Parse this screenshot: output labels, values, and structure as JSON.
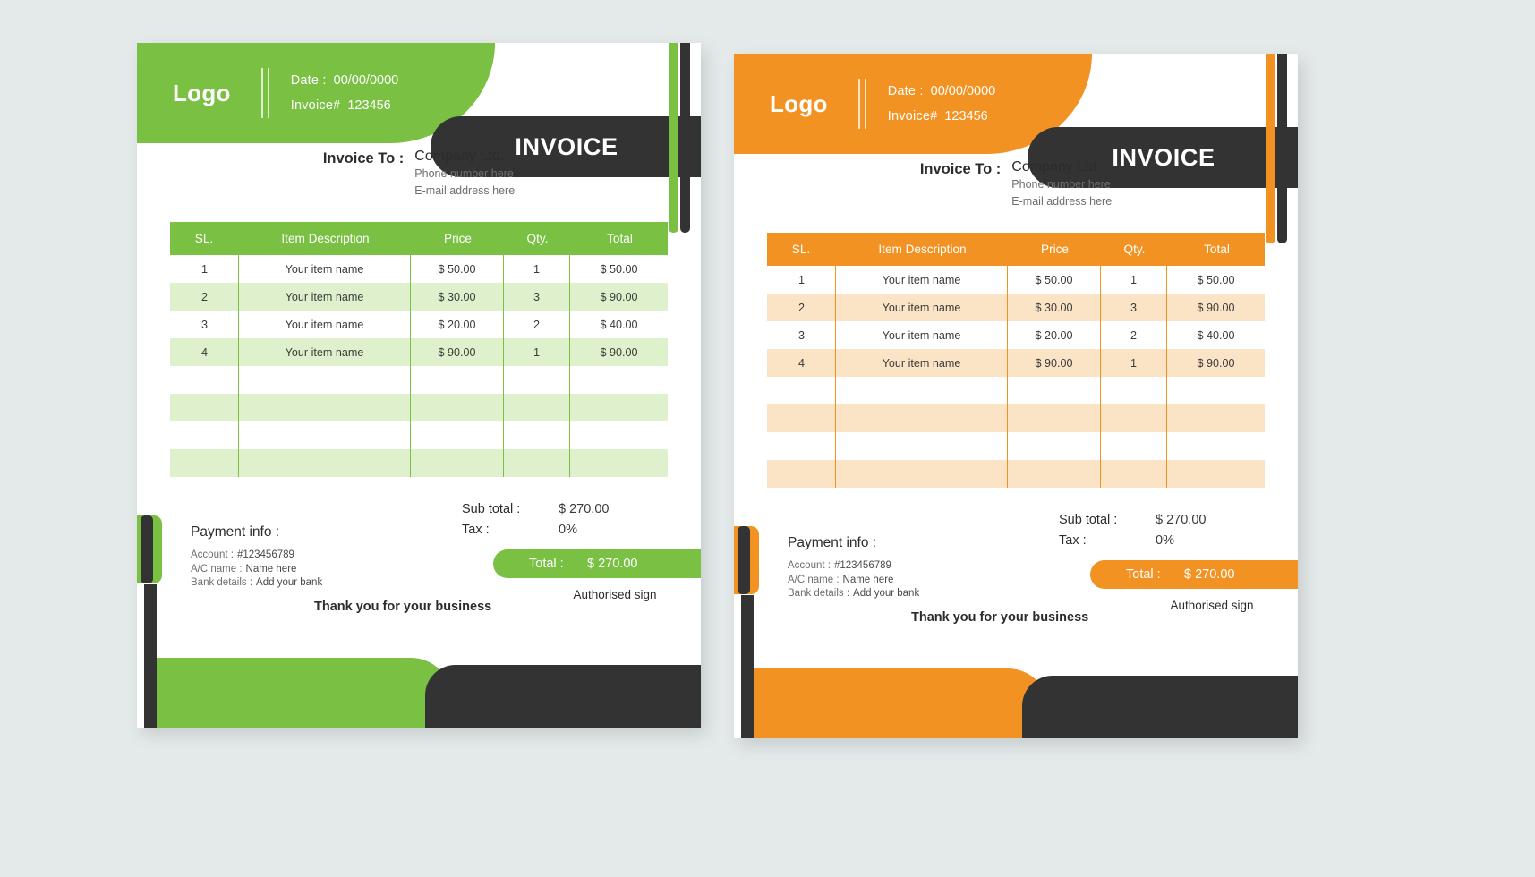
{
  "cards": [
    {
      "theme": "green",
      "accent": "#7ac043",
      "row_alt": "#dff0cd",
      "dark": "#333333",
      "logo": "Logo",
      "header": {
        "date_label": "Date :",
        "date_value": "00/00/0000",
        "invoice_label": "Invoice#",
        "invoice_value": "123456",
        "title": "INVOICE"
      },
      "invoice_to": {
        "label": "Invoice To :",
        "company": "Company Ltd.",
        "phone": "Phone number here",
        "email": "E-mail address here"
      },
      "table": {
        "columns": [
          "SL.",
          "Item Description",
          "Price",
          "Qty.",
          "Total"
        ],
        "rows": [
          {
            "sl": "1",
            "desc": "Your item name",
            "price": "$ 50.00",
            "qty": "1",
            "total": "$ 50.00"
          },
          {
            "sl": "2",
            "desc": "Your item name",
            "price": "$ 30.00",
            "qty": "3",
            "total": "$ 90.00"
          },
          {
            "sl": "3",
            "desc": "Your item name",
            "price": "$ 20.00",
            "qty": "2",
            "total": "$ 40.00"
          },
          {
            "sl": "4",
            "desc": "Your item name",
            "price": "$ 90.00",
            "qty": "1",
            "total": "$ 90.00"
          },
          {
            "sl": "",
            "desc": "",
            "price": "",
            "qty": "",
            "total": ""
          },
          {
            "sl": "",
            "desc": "",
            "price": "",
            "qty": "",
            "total": ""
          },
          {
            "sl": "",
            "desc": "",
            "price": "",
            "qty": "",
            "total": ""
          },
          {
            "sl": "",
            "desc": "",
            "price": "",
            "qty": "",
            "total": ""
          }
        ]
      },
      "totals": {
        "subtotal_label": "Sub total :",
        "subtotal_value": "$ 270.00",
        "tax_label": "Tax :",
        "tax_value": "0%",
        "total_label": "Total :",
        "total_value": "$ 270.00"
      },
      "payment": {
        "title": "Payment info :",
        "account_label": "Account :",
        "account_value": "#123456789",
        "ac_name_label": "A/C name :",
        "ac_name_value": "Name here",
        "bank_label": "Bank details :",
        "bank_value": "Add your bank"
      },
      "footer": {
        "thanks": "Thank you for your business",
        "sign_label": "Authorised sign"
      }
    },
    {
      "theme": "orange",
      "accent": "#f29222",
      "row_alt": "#fbe3c6",
      "dark": "#333333",
      "logo": "Logo",
      "header": {
        "date_label": "Date :",
        "date_value": "00/00/0000",
        "invoice_label": "Invoice#",
        "invoice_value": "123456",
        "title": "INVOICE"
      },
      "invoice_to": {
        "label": "Invoice To :",
        "company": "Company Ltd.",
        "phone": "Phone number here",
        "email": "E-mail address here"
      },
      "table": {
        "columns": [
          "SL.",
          "Item Description",
          "Price",
          "Qty.",
          "Total"
        ],
        "rows": [
          {
            "sl": "1",
            "desc": "Your item name",
            "price": "$ 50.00",
            "qty": "1",
            "total": "$ 50.00"
          },
          {
            "sl": "2",
            "desc": "Your item name",
            "price": "$ 30.00",
            "qty": "3",
            "total": "$ 90.00"
          },
          {
            "sl": "3",
            "desc": "Your item name",
            "price": "$ 20.00",
            "qty": "2",
            "total": "$ 40.00"
          },
          {
            "sl": "4",
            "desc": "Your item name",
            "price": "$ 90.00",
            "qty": "1",
            "total": "$ 90.00"
          },
          {
            "sl": "",
            "desc": "",
            "price": "",
            "qty": "",
            "total": ""
          },
          {
            "sl": "",
            "desc": "",
            "price": "",
            "qty": "",
            "total": ""
          },
          {
            "sl": "",
            "desc": "",
            "price": "",
            "qty": "",
            "total": ""
          },
          {
            "sl": "",
            "desc": "",
            "price": "",
            "qty": "",
            "total": ""
          }
        ]
      },
      "totals": {
        "subtotal_label": "Sub total :",
        "subtotal_value": "$ 270.00",
        "tax_label": "Tax :",
        "tax_value": "0%",
        "total_label": "Total :",
        "total_value": "$ 270.00"
      },
      "payment": {
        "title": "Payment info :",
        "account_label": "Account :",
        "account_value": "#123456789",
        "ac_name_label": "A/C name :",
        "ac_name_value": "Name here",
        "bank_label": "Bank details :",
        "bank_value": "Add your bank"
      },
      "footer": {
        "thanks": "Thank you for your business",
        "sign_label": "Authorised sign"
      }
    }
  ]
}
